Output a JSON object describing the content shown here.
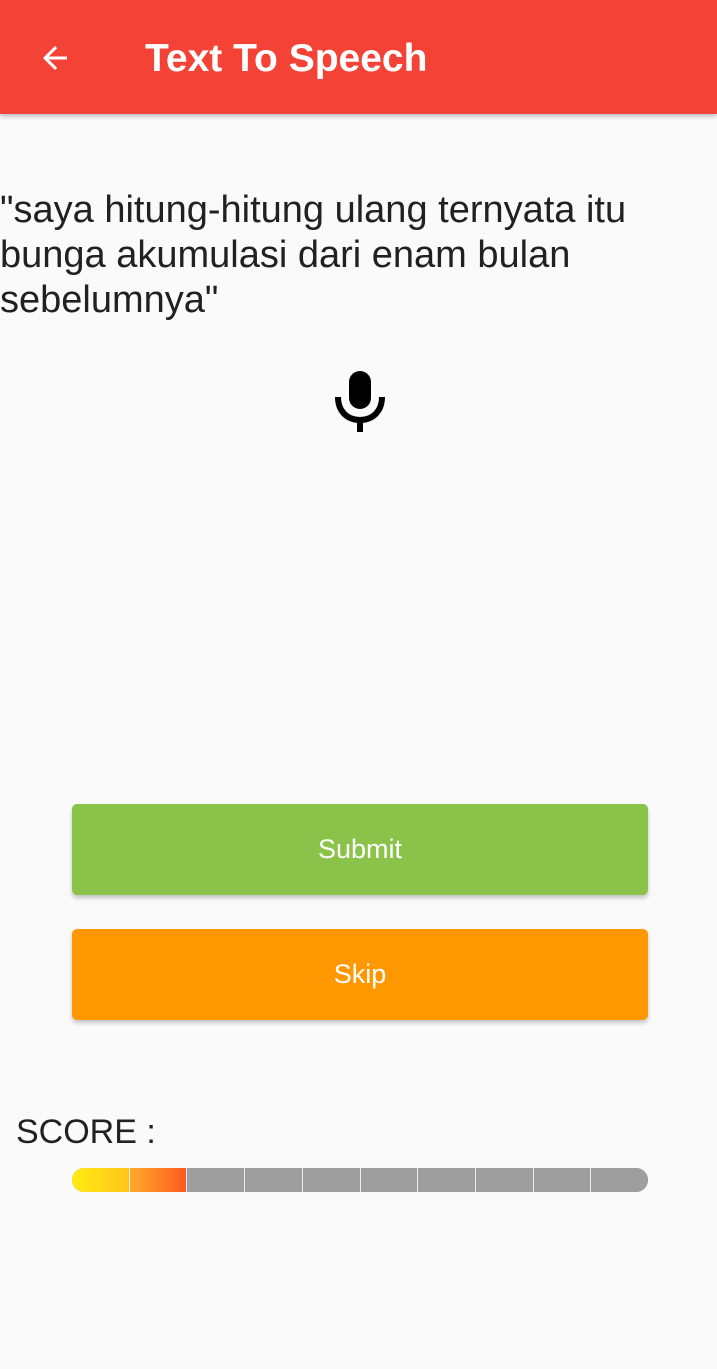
{
  "app_bar": {
    "title": "Text To Speech",
    "back_icon": "arrow-back-icon"
  },
  "prompt": {
    "text": "\"saya hitung-hitung ulang ternyata itu bunga akumulasi dari enam bulan sebelumnya\""
  },
  "mic": {
    "icon": "microphone-icon"
  },
  "buttons": {
    "submit_label": "Submit",
    "skip_label": "Skip"
  },
  "score": {
    "label": "SCORE :",
    "filled_segments": 2,
    "total_segments": 10
  },
  "colors": {
    "primary": "#f44336",
    "submit": "#8bc34a",
    "skip": "#ff9800",
    "score_empty": "#9e9e9e"
  }
}
